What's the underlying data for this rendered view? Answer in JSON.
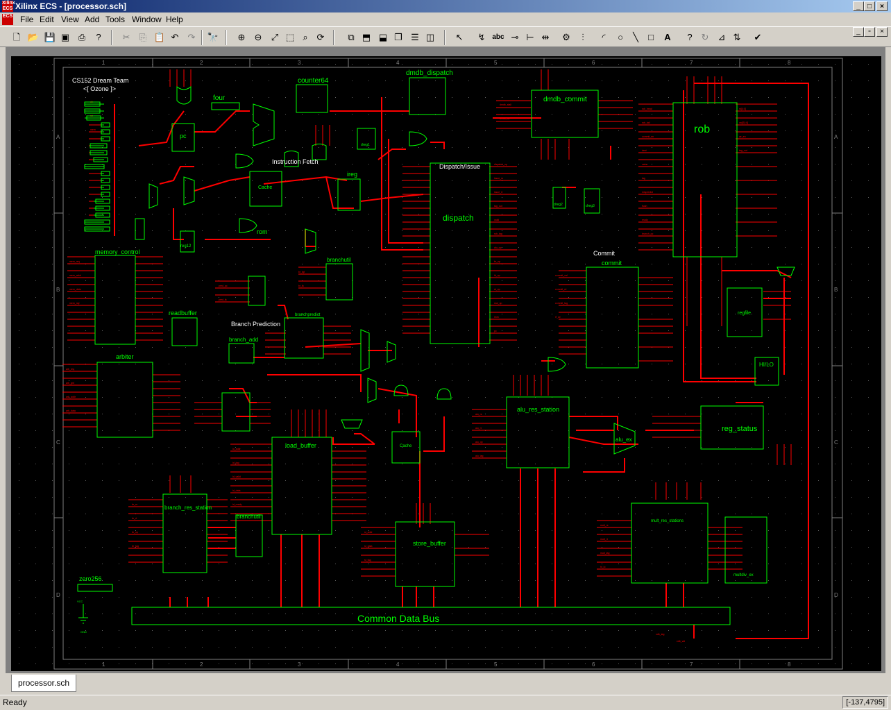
{
  "app": {
    "icon_text": "Xilinx ECS",
    "title": "Xilinx ECS - [processor.sch]"
  },
  "menu": [
    "File",
    "Edit",
    "View",
    "Add",
    "Tools",
    "Window",
    "Help"
  ],
  "toolbar": {
    "text_tool": "abc"
  },
  "schematic": {
    "frame_cols": [
      "1",
      "2",
      "3",
      "4",
      "5",
      "6",
      "7",
      "8"
    ],
    "frame_rows": [
      "A",
      "B",
      "C",
      "D"
    ],
    "headings": {
      "team": "CS152 Dream Team",
      "ozone": "<[ Ozone ]>",
      "fetch": "Instruction Fetch",
      "dispatch": "Dispatch/Issue",
      "branch_prediction": "Branch Prediction",
      "commit": "Commit"
    },
    "blocks": {
      "four": "four",
      "pc": "pc",
      "counter64": "counter64",
      "dmdb_dispatch": "dmdb_dispatch",
      "dmdb_commit": "dmdb_commit",
      "rob": "rob",
      "dispatch": "dispatch",
      "ireg": "ireg",
      "cache": "Cache",
      "rom": "rom",
      "reg12": "reg12",
      "memory_control": "memory_control",
      "branchutil_top": "branchutil",
      "readbuffer": "readbuffer",
      "branch_add": "branch_add",
      "branchpredict": "branchpredict",
      "arbiter": "arbiter",
      "commit": "commit",
      "regfile": "regfile",
      "hilo": "HI/LO",
      "alu_res_station": "alu_res_station",
      "alu_ex": "alu_ex",
      "reg_status": "reg_status",
      "load_buffer": "load_buffer",
      "dcache": "Cache",
      "branch_res_station": "branch_res_station",
      "branchutil_bottom": "branchutil",
      "store_buffer": "store_buffer",
      "mult_res_stations": "mult_res_stations",
      "mult_ex": "multdiv_ex",
      "zero256": "zero256",
      "cdb": "Common Data Bus",
      "vcc": "VCC",
      "gnd": "GND",
      "dreg1": "dreg1",
      "dreg2": "dreg2",
      "dreg3": "dreg3"
    }
  },
  "tab": "processor.sch",
  "status": {
    "ready": "Ready",
    "coords": "[-137,4795]"
  },
  "colors": {
    "wire": "#ff0000",
    "symbol": "#00ff00",
    "background": "#000000",
    "frame": "#808080"
  }
}
